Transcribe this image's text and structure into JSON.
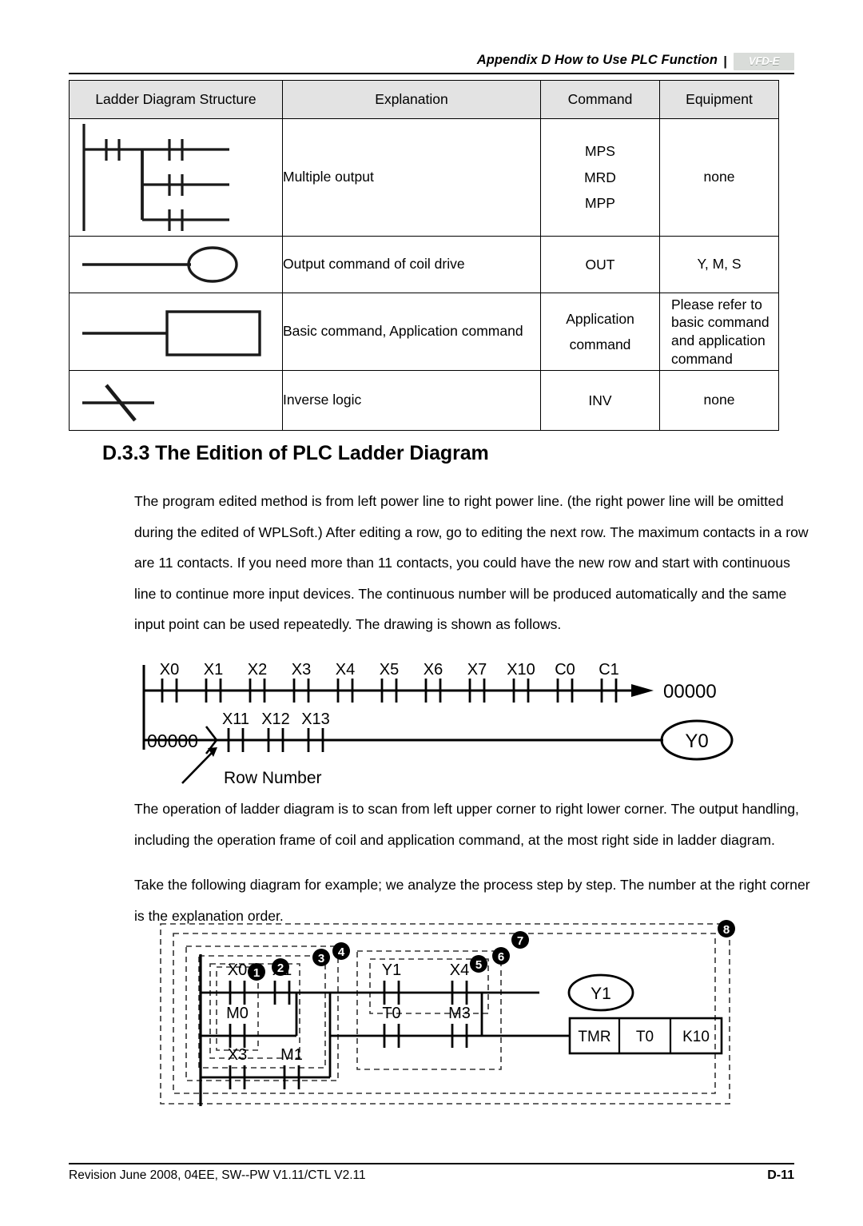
{
  "header": {
    "title": "Appendix D How to Use PLC Function",
    "separator": "|",
    "logo": "VFD-E"
  },
  "symbol_table": {
    "columns": [
      "Ladder Diagram Structure",
      "Explanation",
      "Command",
      "Equipment"
    ],
    "rows": [
      {
        "symbol": "multiple-output-branch",
        "explanation": "Multiple output",
        "command": "MPS\nMRD\nMPP",
        "command_lines": [
          "MPS",
          "MRD",
          "MPP"
        ],
        "equipment": "none"
      },
      {
        "symbol": "output-coil",
        "explanation": "Output command of coil drive",
        "command": "OUT",
        "equipment": "Y, M, S"
      },
      {
        "symbol": "application-instruction-box",
        "explanation": "Basic command, Application command",
        "command": "Application command",
        "equipment": "Please refer to basic command and application command"
      },
      {
        "symbol": "inverse-logic-slash",
        "explanation": "Inverse logic",
        "command": "INV",
        "equipment": "none"
      }
    ]
  },
  "section": {
    "heading": "D.3.3 The Edition of PLC Ladder Diagram",
    "paragraph1": "The program edited method is from left power line to right power line. (the right power line will be omitted during the edited of WPLSoft.) After editing a row, go to editing the next row. The maximum contacts in a row are 11 contacts. If you need more than 11 contacts, you could have the new row and start with continuous line to continue more input devices. The continuous number will be produced automatically and the same input point can be used repeatedly. The drawing is shown as follows.",
    "paragraph2": "The operation of ladder diagram is to scan from left upper corner to right lower corner. The output handling, including the operation frame of coil and application command, at the most right side in ladder diagram.",
    "paragraph3": "Take the following diagram for example; we analyze the process step by step. The number at the right corner is the explanation order."
  },
  "diagram_row_number": {
    "row1_contacts": [
      "X0",
      "X1",
      "X2",
      "X3",
      "X4",
      "X5",
      "X6",
      "X7",
      "X10",
      "C0",
      "C1"
    ],
    "row1_target": "00000",
    "row2_rownumber": "00000",
    "row2_contacts": [
      "X11",
      "X12",
      "X13"
    ],
    "row2_coil": "Y0",
    "annotation": "Row Number"
  },
  "diagram_analysis": {
    "contacts": {
      "branch1_top": "X0",
      "branch1_mid": "M0",
      "branch2_top": "X1",
      "branch3_bottom_a": "X3",
      "branch3_bottom_b": "M1",
      "branch4_top_a": "Y1",
      "branch4_top_b": "X4",
      "branch4_mid_a": "T0",
      "branch4_mid_b": "M3"
    },
    "coil": "Y1",
    "instruction_box": [
      "TMR",
      "T0",
      "K10"
    ],
    "callouts": [
      "1",
      "2",
      "3",
      "4",
      "5",
      "6",
      "7",
      "8"
    ]
  },
  "footer": {
    "revision": "Revision June 2008, 04EE, SW--PW V1.11/CTL V2.11",
    "page": "D-11"
  }
}
